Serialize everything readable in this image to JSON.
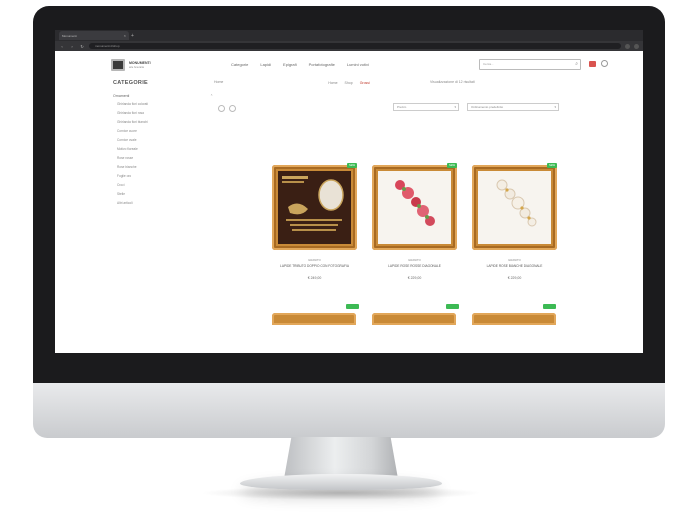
{
  "browser": {
    "tab_title": "Monumenti",
    "url": "monumenti.it/shop"
  },
  "header": {
    "brand_name": "MONUMENTI",
    "brand_tagline": "arte funeraria",
    "nav": [
      "Categorie",
      "Lapidi",
      "Epigrafi",
      "Portafotografie",
      "Lumini votivi"
    ],
    "search_placeholder": "Cerca..."
  },
  "subnav": [
    "Home",
    "Shop",
    "Grossi"
  ],
  "sidebar": {
    "title": "CATEGORIE",
    "section": "Ornamenti",
    "items": [
      "Ghirlanda fiori colorati",
      "Ghirlanda fiori rosa",
      "Ghirlanda fiori bianchi",
      "Cornice cuore",
      "Cornice ovale",
      "Motivo floreale",
      "Rose rosse",
      "Rose bianche",
      "Foglie oro",
      "Croci",
      "Stelle",
      "Altri articoli"
    ]
  },
  "main": {
    "breadcrumb": "Home",
    "sort_info": "Visualizzazione di 12 risultati",
    "select_1": "Prezzo",
    "select_2": "Ordinamento predefinito",
    "products": [
      {
        "badge": "NEW",
        "brand": "GRANITO",
        "name": "LAPIDE TRIBUTO DOPPIO CON FOTOGRAFIA",
        "price": "€ 249,00"
      },
      {
        "badge": "NEW",
        "brand": "GRANITO",
        "name": "LAPIDE ROSE ROSSE DIAGONALE",
        "price": "€ 229,00"
      },
      {
        "badge": "NEW",
        "brand": "GRANITO",
        "name": "LAPIDE ROSE BIANCHE DIAGONALE",
        "price": "€ 229,00"
      }
    ]
  },
  "colors": {
    "accent": "#c0392b",
    "badge": "#3cba54",
    "frame_gold": "#c98a37"
  }
}
